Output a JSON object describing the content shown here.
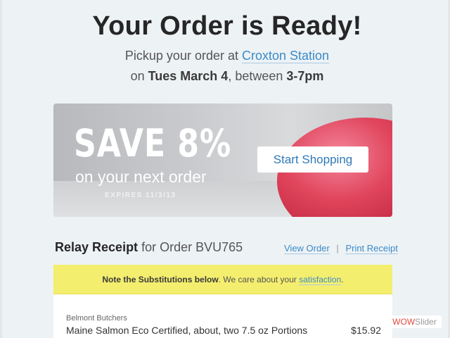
{
  "header": {
    "title": "Your Order is Ready!",
    "pickup_prefix": "Pickup your order at",
    "pickup_location": "Croxton Station",
    "date_prefix": "on",
    "date": "Tues March 4",
    "date_between": ", between",
    "time": "3-7pm"
  },
  "banner": {
    "headline": "SAVE 8%",
    "subline": "on your next order",
    "expires": "EXPIRES 11/3/13",
    "button_label": "Start Shopping"
  },
  "receipt": {
    "title_bold": "Relay Receipt",
    "title_rest": " for Order BVU765",
    "view_order": "View Order",
    "separator": "|",
    "print_receipt": "Print Receipt"
  },
  "note": {
    "bold": "Note the Substitutions below",
    "text": ". We care about your ",
    "link": "satisfaction",
    "end": "."
  },
  "items": [
    {
      "vendor": "Belmont Butchers",
      "name": "Maine Salmon Eco Certified, about, two 7.5 oz Portions",
      "price": "$15.92"
    }
  ],
  "watermark": {
    "wow": "WOW",
    "slider": "Slider"
  }
}
